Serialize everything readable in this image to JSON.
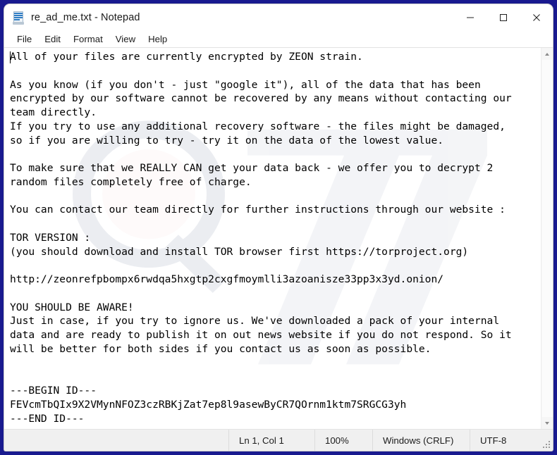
{
  "window": {
    "title": "re_ad_me.txt - Notepad",
    "icon": "notepad-icon",
    "controls": {
      "minimize": "–",
      "maximize": "□",
      "close": "✕"
    }
  },
  "menubar": {
    "items": [
      {
        "label": "File"
      },
      {
        "label": "Edit"
      },
      {
        "label": "Format"
      },
      {
        "label": "View"
      },
      {
        "label": "Help"
      }
    ]
  },
  "editor": {
    "content": "All of your files are currently encrypted by ZEON strain.\n\nAs you know (if you don't - just \"google it\"), all of the data that has been\nencrypted by our software cannot be recovered by any means without contacting our\nteam directly.\nIf you try to use any additional recovery software - the files might be damaged,\nso if you are willing to try - try it on the data of the lowest value.\n\nTo make sure that we REALLY CAN get your data back - we offer you to decrypt 2\nrandom files completely free of charge.\n\nYou can contact our team directly for further instructions through our website :\n\nTOR VERSION :\n(you should download and install TOR browser first https://torproject.org)\n\nhttp://zeonrefpbompx6rwdqa5hxgtp2cxgfmoymlli3azoanisze33pp3x3yd.onion/\n\nYOU SHOULD BE AWARE!\nJust in case, if you try to ignore us. We've downloaded a pack of your internal\ndata and are ready to publish it on out news website if you do not respond. So it\nwill be better for both sides if you contact us as soon as possible.\n\n\n---BEGIN ID---\nFEVcmTbQIx9X2VMynNFOZ3czRBKjZat7ep8l9asewByCR7QOrnm1ktm7SRGCG3yh\n---END ID---"
  },
  "scrollbar": {
    "up_arrow": "scroll-up-arrow",
    "down_arrow": "scroll-down-arrow"
  },
  "statusbar": {
    "line_col": "Ln 1, Col 1",
    "zoom": "100%",
    "line_ending": "Windows (CRLF)",
    "encoding": "UTF-8"
  },
  "colors": {
    "desktop": "#191a8f",
    "window_bg": "#ffffff",
    "statusbar_bg": "#f0f0f0",
    "text": "#000000"
  }
}
